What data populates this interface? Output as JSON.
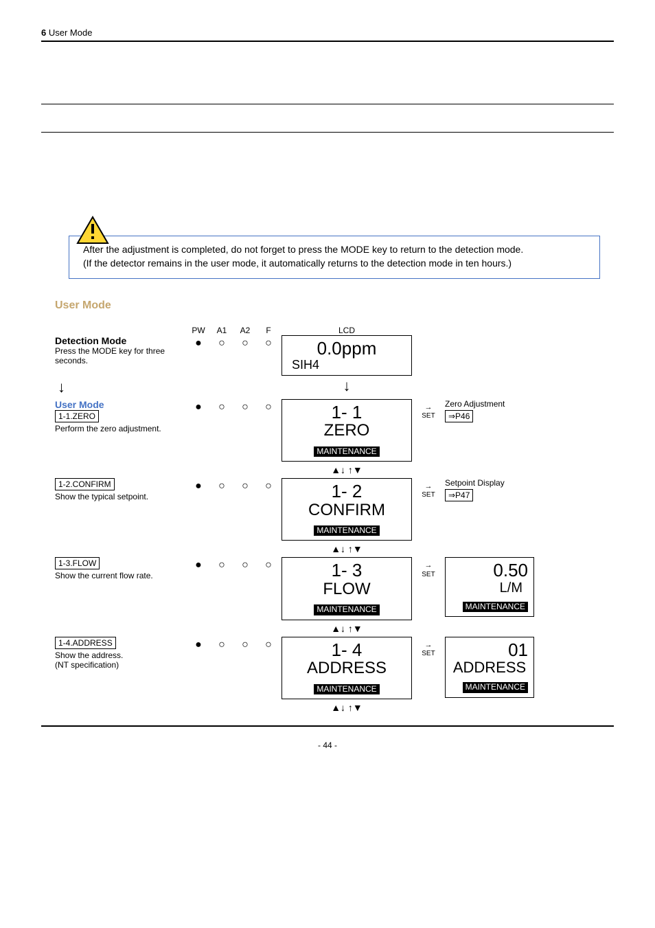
{
  "header": {
    "num": "6",
    "title": "User Mode"
  },
  "caution": {
    "line1": "After the adjustment is completed, do not forget to press the MODE key to return to the detection mode.",
    "line2": "(If the detector remains in the user mode, it automatically returns to the detection mode in ten hours.)"
  },
  "section_title": "User Mode",
  "labels": {
    "pw": "PW",
    "a1": "A1",
    "a2": "A2",
    "f": "F",
    "lcd": "LCD"
  },
  "lamps": {
    "filled": "●",
    "empty": "○"
  },
  "set_label": "SET",
  "arrow_right": "→",
  "arrow_down": "↓",
  "updown_nav": "▲↓ ↑▼",
  "steps": [
    {
      "title": "Detection Mode",
      "caption": "Press the MODE key for three seconds.",
      "code": "",
      "lcd_big": "0.0ppm",
      "lcd_small": "SIH4",
      "lcd_inv": "",
      "has_set": false,
      "ref_title": "",
      "ref_box": "",
      "right_panel": null
    },
    {
      "title": "User Mode",
      "caption": "Perform the zero adjustment.",
      "code": "1-1.ZERO",
      "lcd_big": "1- 1",
      "lcd_sub": "ZERO",
      "lcd_inv": "MAINTENANCE",
      "has_set": true,
      "ref_title": "Zero Adjustment",
      "ref_box": "⇒P46",
      "right_panel": null
    },
    {
      "title": "",
      "caption": "Show the typical setpoint.",
      "code": "1-2.CONFIRM",
      "lcd_big": "1- 2",
      "lcd_sub": "CONFIRM",
      "lcd_inv": "MAINTENANCE",
      "has_set": true,
      "ref_title": "Setpoint Display",
      "ref_box": "⇒P47",
      "right_panel": null
    },
    {
      "title": "",
      "caption": "Show the current flow rate.",
      "code": "1-3.FLOW",
      "lcd_big": "1- 3",
      "lcd_sub": "FLOW",
      "lcd_inv": "MAINTENANCE",
      "has_set": true,
      "ref_title": "",
      "ref_box": "",
      "right_panel": {
        "big": "0.50",
        "sub": "L/M",
        "inv": "MAINTENANCE"
      }
    },
    {
      "title": "",
      "caption": "Show the address.",
      "caption2": "(NT specification)",
      "code": "1-4.ADDRESS",
      "lcd_big": "1- 4",
      "lcd_sub": "ADDRESS",
      "lcd_inv": "MAINTENANCE",
      "has_set": true,
      "ref_title": "",
      "ref_box": "",
      "right_panel": {
        "big": "01",
        "sub": "ADDRESS",
        "inv": "MAINTENANCE"
      }
    }
  ],
  "page_number": "- 44 -"
}
